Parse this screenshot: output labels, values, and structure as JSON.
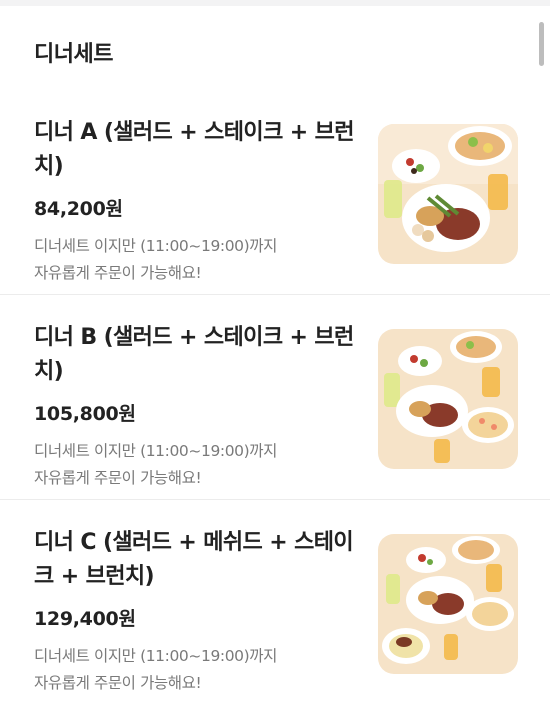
{
  "section": {
    "title": "디너세트"
  },
  "items": [
    {
      "name": "디너 A (샐러드 + 스테이크 + 브런치)",
      "price": "84,200원",
      "desc_line1": "디너세트 이지만 (11:00~19:00)까지",
      "desc_line2": "자유롭게 주문이 가능해요!",
      "image": "food-platter-photo"
    },
    {
      "name": "디너 B (샐러드 + 스테이크 + 브런치)",
      "price": "105,800원",
      "desc_line1": "디너세트 이지만 (11:00~19:00)까지",
      "desc_line2": "자유롭게 주문이 가능해요!",
      "image": "food-platter-photo"
    },
    {
      "name": "디너 C (샐러드 + 메쉬드 + 스테이크 + 브런치)",
      "price": "129,400원",
      "desc_line1": "디너세트 이지만 (11:00~19:00)까지",
      "desc_line2": "자유롭게 주문이 가능해요!",
      "image": "food-platter-photo"
    }
  ],
  "colors": {
    "background": "#ffffff",
    "text": "#222222",
    "muted": "#7a7a7a",
    "divider": "#ececec",
    "photo_bg": "#f6e3c8"
  }
}
